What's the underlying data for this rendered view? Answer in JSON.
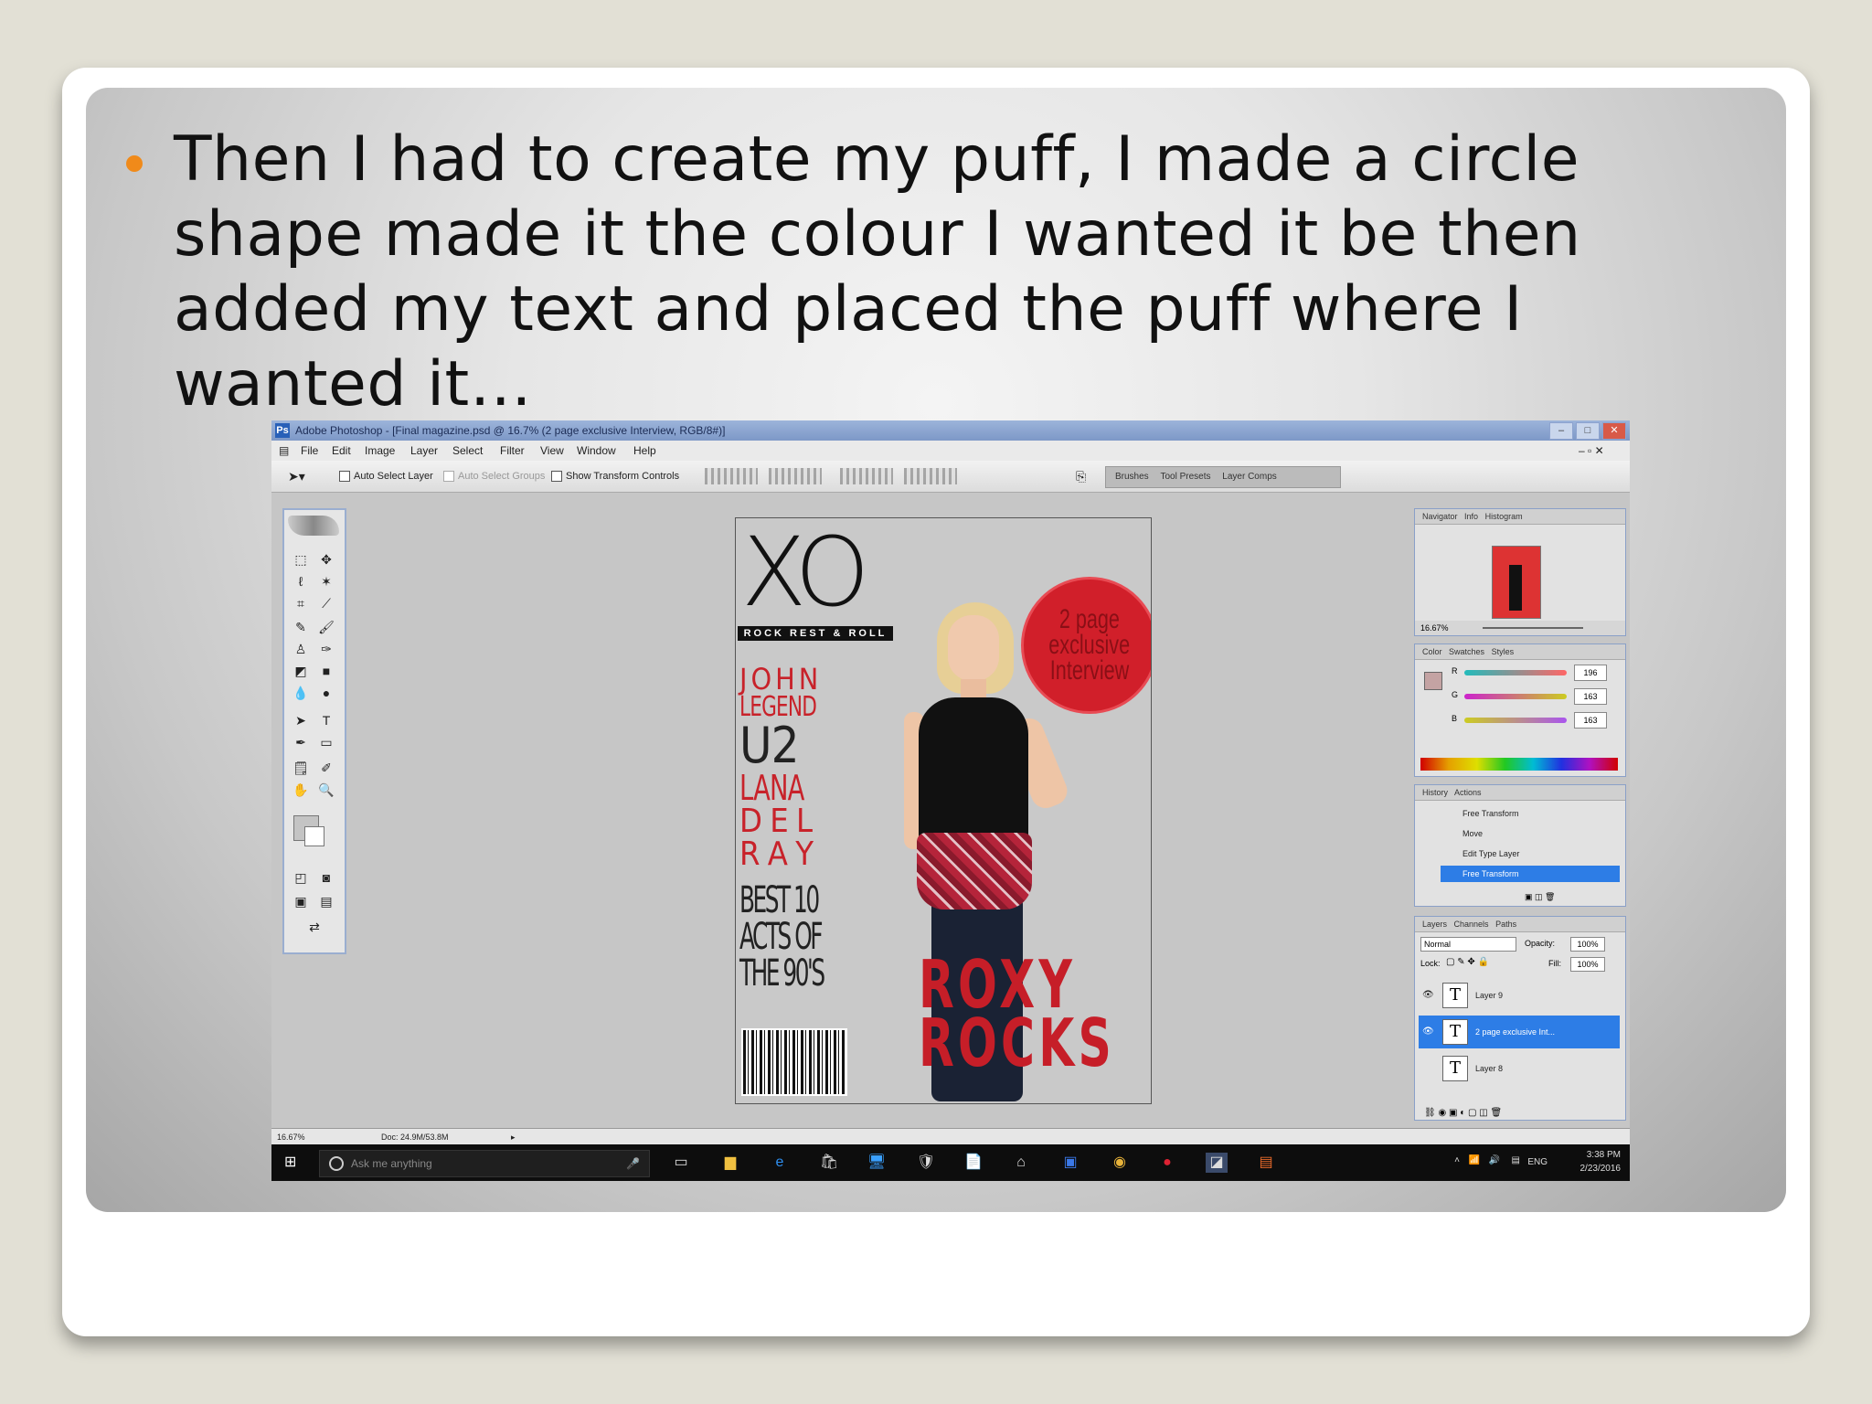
{
  "slide": {
    "bullet_text": "Then I had to create my puff, I made a circle shape made it the colour I wanted it be then added my text and placed the puff where I wanted it…",
    "bullet_color": "#f08a1a"
  },
  "photoshop": {
    "title": "Adobe Photoshop - [Final magazine.psd @ 16.7% (2 page  exclusive  Interview, RGB/8#)]",
    "menu": [
      "File",
      "Edit",
      "Image",
      "Layer",
      "Select",
      "Filter",
      "View",
      "Window",
      "Help"
    ],
    "options": {
      "auto_select_layer": "Auto Select Layer",
      "auto_select_groups": "Auto Select Groups",
      "show_transform_controls": "Show Transform Controls"
    },
    "palette_well_tabs": [
      "Brushes",
      "Tool Presets",
      "Layer Comps"
    ],
    "status": {
      "zoom": "16.67%",
      "doc": "Doc: 24.9M/53.8M"
    },
    "navigator": {
      "tabs": [
        "Navigator",
        "Info",
        "Histogram"
      ],
      "zoom": "16.67%"
    },
    "color_panel": {
      "tabs": [
        "Color",
        "Swatches",
        "Styles"
      ],
      "r_label": "R",
      "g_label": "G",
      "b_label": "B",
      "r": "196",
      "g": "163",
      "b": "163"
    },
    "history": {
      "tabs": [
        "History",
        "Actions"
      ],
      "items": [
        "Free Transform",
        "Move",
        "Edit Type Layer",
        "Free Transform"
      ],
      "selected_index": 3
    },
    "layers": {
      "tabs": [
        "Layers",
        "Channels",
        "Paths"
      ],
      "blend_mode": "Normal",
      "opacity_label": "Opacity:",
      "opacity": "100%",
      "lock_label": "Lock:",
      "fill_label": "Fill:",
      "fill": "100%",
      "rows": [
        "Layer 9",
        "2 page  exclusive  Int...",
        "Layer 8"
      ],
      "selected_index": 1
    }
  },
  "magazine": {
    "masthead": "XO",
    "tagline": "ROCK REST & ROLL",
    "cover_lines": [
      "JOHN",
      "LEGEND",
      "U2",
      "LANA",
      "D E L",
      "R A Y"
    ],
    "best_of": [
      "BEST 10",
      "ACTS OF",
      "THE 90'S"
    ],
    "puff": [
      "2 page",
      "exclusive",
      "Interview"
    ],
    "headline": [
      "ROXY",
      "ROCKS"
    ],
    "accent_color": "#c8222a"
  },
  "taskbar": {
    "search_placeholder": "Ask me anything",
    "language": "ENG",
    "time": "3:38 PM",
    "date": "2/23/2016"
  }
}
